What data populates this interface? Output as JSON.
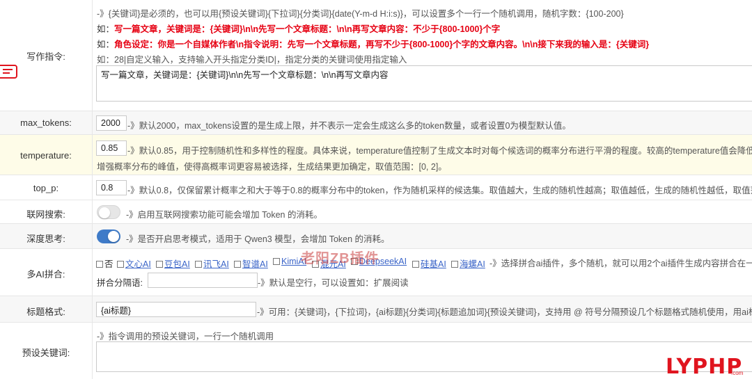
{
  "writing": {
    "label": "写作指令:",
    "hint1": "-》{关键词}是必须的，也可以用{预设关键词}{下拉词}{分类词}{date(Y-m-d H:i:s)}，可以设置多个一行一个随机调用，随机字数：{100-200}",
    "ex1_prefix": "如：",
    "ex1_text": "写一篇文章，关键词是：{关键词}\\n\\n先写一个文章标题：\\n\\n再写文章内容：不少于{800-1000}个字",
    "ex2_prefix": "如：",
    "ex2_text": "角色设定：你是一个自媒体作者\\n指令说明：先写一个文章标题，再写不少于{800-1000}个字的文章内容。\\n\\n接下来我的输入是：{关键词}",
    "ex3": "如：28|自定义输入，支持输入开头指定分类ID|，指定分类的关键词使用指定输入",
    "value": "写一篇文章，关键词是：{关键词}\\n\\n先写一个文章标题：\\n\\n再写文章内容"
  },
  "max_tokens": {
    "label": "max_tokens:",
    "value": "2000",
    "hint": "-》默认2000，max_tokens设置的是生成上限，并不表示一定会生成这么多的token数量，或者设置0为模型默认值。"
  },
  "temperature": {
    "label": "temperature:",
    "value": "0.85",
    "hint1": "-》默认0.85，用于控制随机性和多样性的程度。具体来说，temperature值控制了生成文本时对每个候选词的概率分布进行平滑的程度。较高的temperature值会降低",
    "hint2": "增强概率分布的峰值，使得高概率词更容易被选择，生成结果更加确定，取值范围：[0, 2]。"
  },
  "top_p": {
    "label": "top_p:",
    "value": "0.8",
    "hint": "-》默认0.8，仅保留累计概率之和大于等于0.8的概率分布中的token，作为随机采样的候选集。取值越大，生成的随机性越高；取值越低，生成的随机性越低，取值范"
  },
  "web_search": {
    "label": "联网搜索:",
    "enabled": false,
    "hint": "-》启用互联网搜索功能可能会增加 Token 的消耗。"
  },
  "deep_think": {
    "label": "深度思考:",
    "enabled": true,
    "hint": "-》是否开启思考模式，适用于 Qwen3 模型，会增加 Token 的消耗。"
  },
  "multi_ai": {
    "label": "多AI拼合:",
    "options": [
      "否",
      "文心AI",
      "豆包AI",
      "讯飞AI",
      "智谱AI",
      "KimiAI",
      "混元AI",
      "DeepseekAI",
      "硅基AI",
      "海螺AI"
    ],
    "hint": "-》选择拼合ai插件，多个随机，就可以用2个ai插件生成内容拼合在一",
    "sep_label": "拼合分隔语:",
    "sep_value": "",
    "sep_hint": "-》默认是空行，可以设置如：扩展阅读"
  },
  "title_format": {
    "label": "标题格式:",
    "value": "{ai标题}",
    "hint": "-》可用：{关键词}，{下拉词}，{ai标题}{分类词}{标题追加词}{预设关键词}，支持用 @ 符号分隔预设几个标题格式随机使用，用ai标"
  },
  "preset_kw": {
    "label": "预设关键词:",
    "hint": "-》指令调用的预设关键词，一行一个随机调用",
    "value": ""
  },
  "watermark": "老阳ZB插件",
  "logo": {
    "text": "LYPHP",
    "sub": ".com"
  },
  "colors": {
    "accent": "#3f7bc8",
    "danger": "#e60012",
    "link": "#3a64c8",
    "highlight_row": "#fefce8"
  }
}
